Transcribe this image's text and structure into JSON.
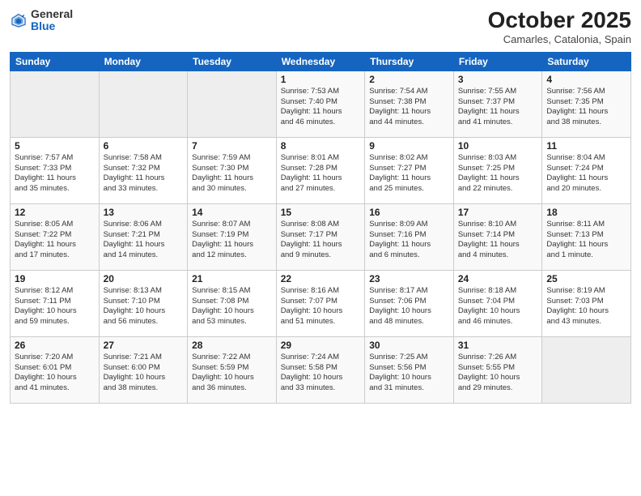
{
  "header": {
    "logo_general": "General",
    "logo_blue": "Blue",
    "month_title": "October 2025",
    "location": "Camarles, Catalonia, Spain"
  },
  "weekdays": [
    "Sunday",
    "Monday",
    "Tuesday",
    "Wednesday",
    "Thursday",
    "Friday",
    "Saturday"
  ],
  "weeks": [
    [
      {
        "day": "",
        "info": ""
      },
      {
        "day": "",
        "info": ""
      },
      {
        "day": "",
        "info": ""
      },
      {
        "day": "1",
        "info": "Sunrise: 7:53 AM\nSunset: 7:40 PM\nDaylight: 11 hours\nand 46 minutes."
      },
      {
        "day": "2",
        "info": "Sunrise: 7:54 AM\nSunset: 7:38 PM\nDaylight: 11 hours\nand 44 minutes."
      },
      {
        "day": "3",
        "info": "Sunrise: 7:55 AM\nSunset: 7:37 PM\nDaylight: 11 hours\nand 41 minutes."
      },
      {
        "day": "4",
        "info": "Sunrise: 7:56 AM\nSunset: 7:35 PM\nDaylight: 11 hours\nand 38 minutes."
      }
    ],
    [
      {
        "day": "5",
        "info": "Sunrise: 7:57 AM\nSunset: 7:33 PM\nDaylight: 11 hours\nand 35 minutes."
      },
      {
        "day": "6",
        "info": "Sunrise: 7:58 AM\nSunset: 7:32 PM\nDaylight: 11 hours\nand 33 minutes."
      },
      {
        "day": "7",
        "info": "Sunrise: 7:59 AM\nSunset: 7:30 PM\nDaylight: 11 hours\nand 30 minutes."
      },
      {
        "day": "8",
        "info": "Sunrise: 8:01 AM\nSunset: 7:28 PM\nDaylight: 11 hours\nand 27 minutes."
      },
      {
        "day": "9",
        "info": "Sunrise: 8:02 AM\nSunset: 7:27 PM\nDaylight: 11 hours\nand 25 minutes."
      },
      {
        "day": "10",
        "info": "Sunrise: 8:03 AM\nSunset: 7:25 PM\nDaylight: 11 hours\nand 22 minutes."
      },
      {
        "day": "11",
        "info": "Sunrise: 8:04 AM\nSunset: 7:24 PM\nDaylight: 11 hours\nand 20 minutes."
      }
    ],
    [
      {
        "day": "12",
        "info": "Sunrise: 8:05 AM\nSunset: 7:22 PM\nDaylight: 11 hours\nand 17 minutes."
      },
      {
        "day": "13",
        "info": "Sunrise: 8:06 AM\nSunset: 7:21 PM\nDaylight: 11 hours\nand 14 minutes."
      },
      {
        "day": "14",
        "info": "Sunrise: 8:07 AM\nSunset: 7:19 PM\nDaylight: 11 hours\nand 12 minutes."
      },
      {
        "day": "15",
        "info": "Sunrise: 8:08 AM\nSunset: 7:17 PM\nDaylight: 11 hours\nand 9 minutes."
      },
      {
        "day": "16",
        "info": "Sunrise: 8:09 AM\nSunset: 7:16 PM\nDaylight: 11 hours\nand 6 minutes."
      },
      {
        "day": "17",
        "info": "Sunrise: 8:10 AM\nSunset: 7:14 PM\nDaylight: 11 hours\nand 4 minutes."
      },
      {
        "day": "18",
        "info": "Sunrise: 8:11 AM\nSunset: 7:13 PM\nDaylight: 11 hours\nand 1 minute."
      }
    ],
    [
      {
        "day": "19",
        "info": "Sunrise: 8:12 AM\nSunset: 7:11 PM\nDaylight: 10 hours\nand 59 minutes."
      },
      {
        "day": "20",
        "info": "Sunrise: 8:13 AM\nSunset: 7:10 PM\nDaylight: 10 hours\nand 56 minutes."
      },
      {
        "day": "21",
        "info": "Sunrise: 8:15 AM\nSunset: 7:08 PM\nDaylight: 10 hours\nand 53 minutes."
      },
      {
        "day": "22",
        "info": "Sunrise: 8:16 AM\nSunset: 7:07 PM\nDaylight: 10 hours\nand 51 minutes."
      },
      {
        "day": "23",
        "info": "Sunrise: 8:17 AM\nSunset: 7:06 PM\nDaylight: 10 hours\nand 48 minutes."
      },
      {
        "day": "24",
        "info": "Sunrise: 8:18 AM\nSunset: 7:04 PM\nDaylight: 10 hours\nand 46 minutes."
      },
      {
        "day": "25",
        "info": "Sunrise: 8:19 AM\nSunset: 7:03 PM\nDaylight: 10 hours\nand 43 minutes."
      }
    ],
    [
      {
        "day": "26",
        "info": "Sunrise: 7:20 AM\nSunset: 6:01 PM\nDaylight: 10 hours\nand 41 minutes."
      },
      {
        "day": "27",
        "info": "Sunrise: 7:21 AM\nSunset: 6:00 PM\nDaylight: 10 hours\nand 38 minutes."
      },
      {
        "day": "28",
        "info": "Sunrise: 7:22 AM\nSunset: 5:59 PM\nDaylight: 10 hours\nand 36 minutes."
      },
      {
        "day": "29",
        "info": "Sunrise: 7:24 AM\nSunset: 5:58 PM\nDaylight: 10 hours\nand 33 minutes."
      },
      {
        "day": "30",
        "info": "Sunrise: 7:25 AM\nSunset: 5:56 PM\nDaylight: 10 hours\nand 31 minutes."
      },
      {
        "day": "31",
        "info": "Sunrise: 7:26 AM\nSunset: 5:55 PM\nDaylight: 10 hours\nand 29 minutes."
      },
      {
        "day": "",
        "info": ""
      }
    ]
  ]
}
